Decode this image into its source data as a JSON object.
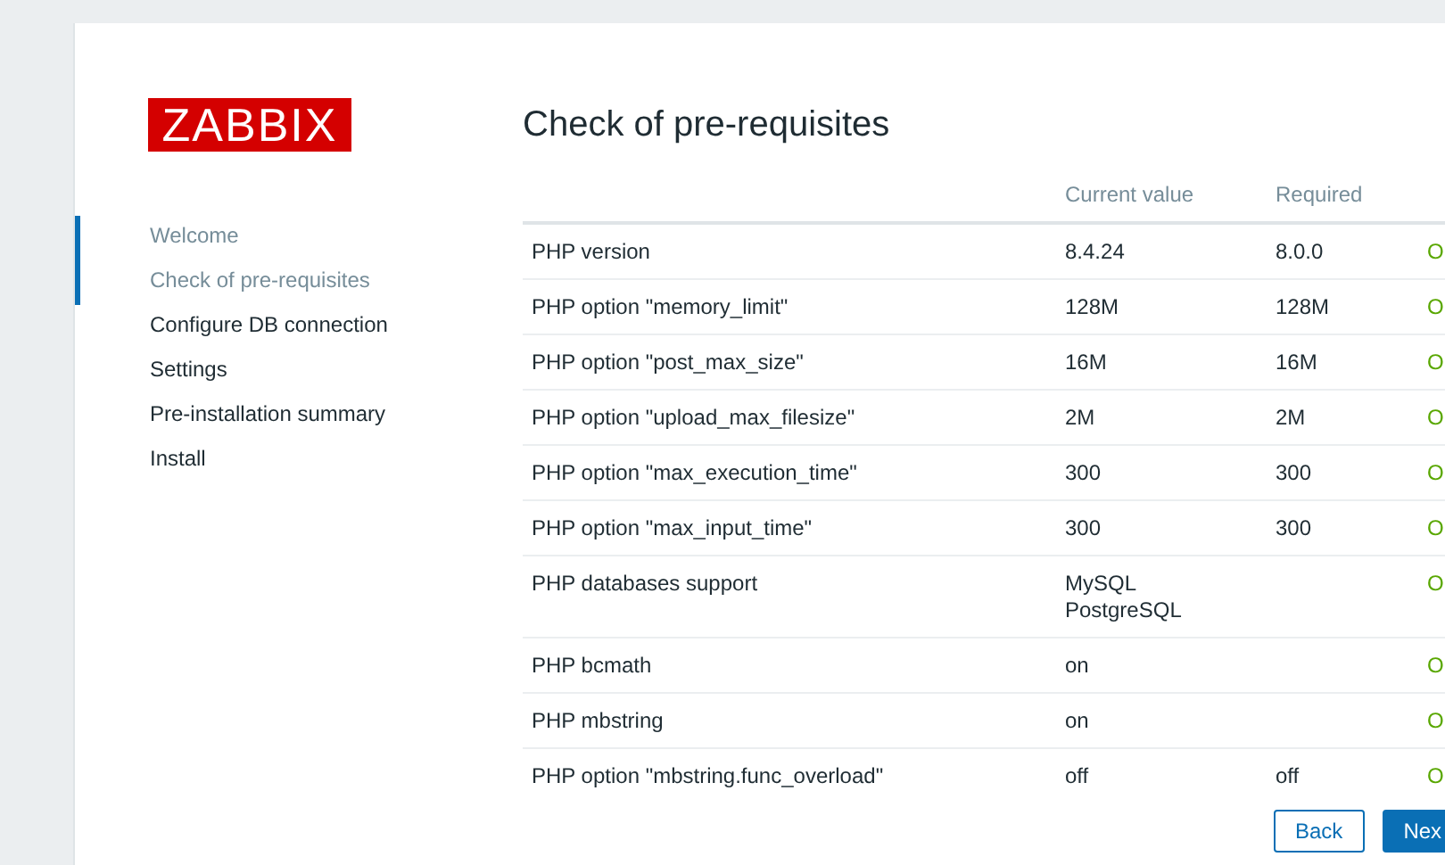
{
  "logo": "ZABBIX",
  "steps": [
    {
      "label": "Welcome",
      "completed": true
    },
    {
      "label": "Check of pre-requisites",
      "completed": true
    },
    {
      "label": "Configure DB connection",
      "completed": false
    },
    {
      "label": "Settings",
      "completed": false
    },
    {
      "label": "Pre-installation summary",
      "completed": false
    },
    {
      "label": "Install",
      "completed": false
    }
  ],
  "title": "Check of pre-requisites",
  "table": {
    "columns": [
      "Current value",
      "Required"
    ],
    "rows": [
      {
        "name": "PHP version",
        "current": [
          "8.4.24"
        ],
        "required": "8.0.0",
        "status": "O"
      },
      {
        "name": "PHP option \"memory_limit\"",
        "current": [
          "128M"
        ],
        "required": "128M",
        "status": "O"
      },
      {
        "name": "PHP option \"post_max_size\"",
        "current": [
          "16M"
        ],
        "required": "16M",
        "status": "O"
      },
      {
        "name": "PHP option \"upload_max_filesize\"",
        "current": [
          "2M"
        ],
        "required": "2M",
        "status": "O"
      },
      {
        "name": "PHP option \"max_execution_time\"",
        "current": [
          "300"
        ],
        "required": "300",
        "status": "O"
      },
      {
        "name": "PHP option \"max_input_time\"",
        "current": [
          "300"
        ],
        "required": "300",
        "status": "O"
      },
      {
        "name": "PHP databases support",
        "current": [
          "MySQL",
          "PostgreSQL"
        ],
        "status": "O"
      },
      {
        "name": "PHP bcmath",
        "current": [
          "on"
        ],
        "status": "O"
      },
      {
        "name": "PHP mbstring",
        "current": [
          "on"
        ],
        "status": "O"
      },
      {
        "name": "PHP option \"mbstring.func_overload\"",
        "current": [
          "off"
        ],
        "required": "off",
        "status": "O"
      }
    ]
  },
  "buttons": [
    {
      "label": "Back",
      "kind": "secondary"
    },
    {
      "label": "Nex",
      "kind": "primary"
    }
  ]
}
